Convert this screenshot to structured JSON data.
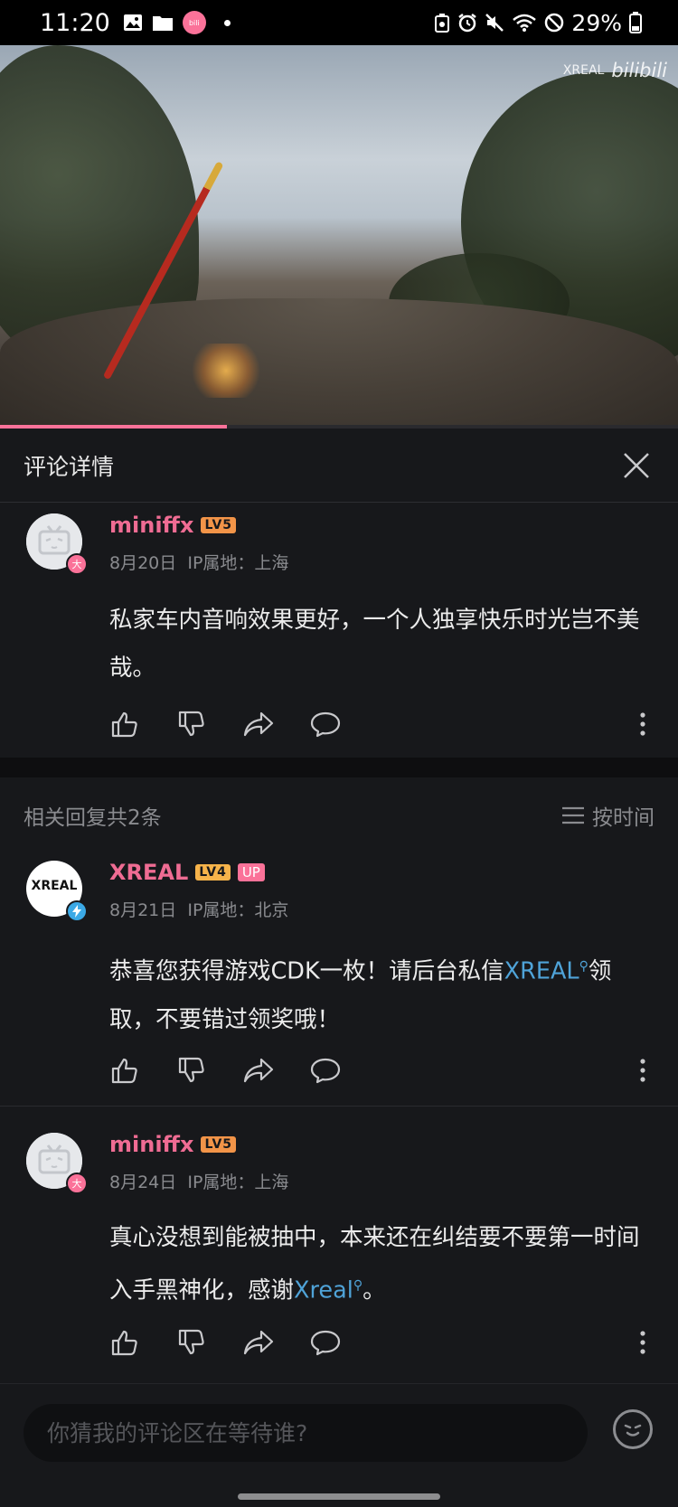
{
  "status_bar": {
    "time": "11:20",
    "battery": "29%",
    "icons_left": [
      "gallery-icon",
      "folder-icon",
      "bilibili-app-icon",
      "dot-icon"
    ],
    "icons_right": [
      "recycle-icon",
      "alarm-icon",
      "mute-icon",
      "wifi-icon",
      "dnd-icon",
      "battery-icon"
    ]
  },
  "video": {
    "watermark_brand": "XREAL",
    "watermark_logo": "bilibili",
    "progress": 0.335
  },
  "panel": {
    "title": "评论详情"
  },
  "main_comment": {
    "username": "miniffx",
    "level": "LV5",
    "date": "8月20日",
    "ip": "IP属地：上海",
    "text": "私家车内音响效果更好，一个人独享快乐时光岂不美哉。",
    "avatar_badge": "大"
  },
  "replies": {
    "count_label": "相关回复共2条",
    "sort_label": "按时间",
    "items": [
      {
        "username": "XREAL",
        "level": "LV4",
        "up_tag": "UP",
        "avatar_text": "XREAL",
        "date": "8月21日",
        "ip": "IP属地：北京",
        "text_before": "恭喜您获得游戏CDK一枚！请后台私信",
        "mention": "XREAL",
        "text_after": "领取，不要错过领奖哦！"
      },
      {
        "username": "miniffx",
        "level": "LV5",
        "avatar_badge": "大",
        "date": "8月24日",
        "ip": "IP属地：上海",
        "text_before": "真心没想到能被抽中，本来还在纠结要不要第一时间入手黑神化，感谢",
        "mention": "Xreal",
        "text_after": "。"
      }
    ]
  },
  "input": {
    "placeholder": "你猜我的评论区在等待谁?"
  },
  "colors": {
    "accent": "#fb7299",
    "username": "#ef6c93",
    "mention": "#4fa3d8",
    "background": "#17181b"
  }
}
